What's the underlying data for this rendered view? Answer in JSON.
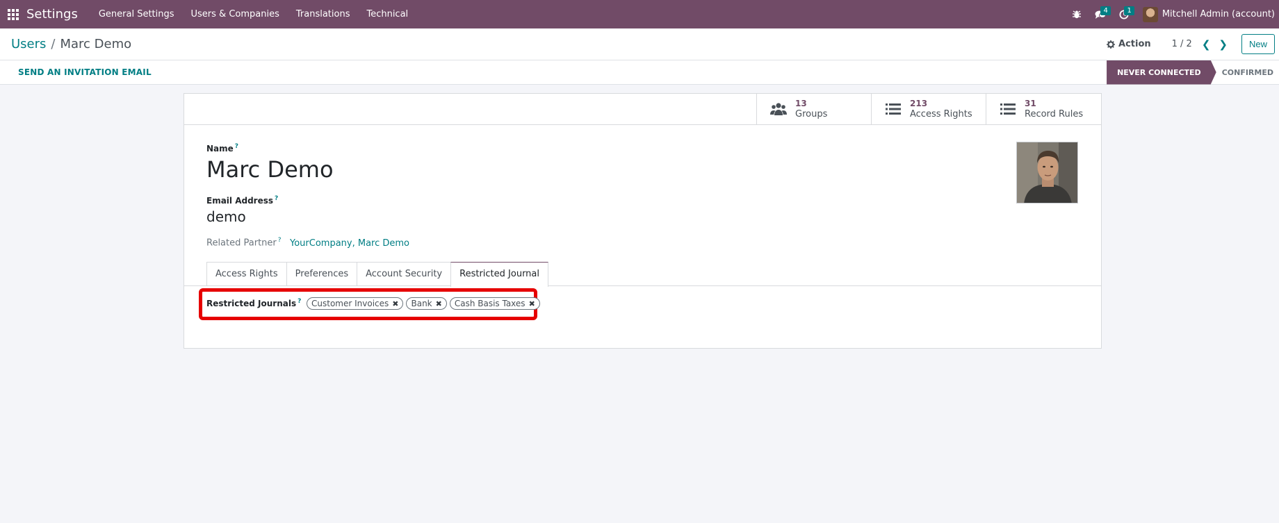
{
  "navbar": {
    "app_name": "Settings",
    "menu": [
      "General Settings",
      "Users & Companies",
      "Translations",
      "Technical"
    ],
    "chat_count": "4",
    "activity_count": "1",
    "user": "Mitchell Admin (account)"
  },
  "control_panel": {
    "breadcrumb_parent": "Users",
    "breadcrumb_separator": "/",
    "breadcrumb_current": "Marc Demo",
    "action_label": "Action",
    "pager": "1 / 2",
    "new_label": "New"
  },
  "statusbar": {
    "invite_label": "SEND AN INVITATION EMAIL",
    "steps": [
      "NEVER CONNECTED",
      "CONFIRMED"
    ]
  },
  "stat_buttons": [
    {
      "value": "13",
      "label": "Groups",
      "icon": "users-icon"
    },
    {
      "value": "213",
      "label": "Access Rights",
      "icon": "list-icon"
    },
    {
      "value": "31",
      "label": "Record Rules",
      "icon": "list-icon"
    }
  ],
  "form": {
    "name_label": "Name",
    "name_value": "Marc Demo",
    "email_label": "Email Address",
    "email_value": "demo",
    "partner_label": "Related Partner",
    "partner_value": "YourCompany, Marc Demo",
    "help_mark": "?"
  },
  "tabs": [
    "Access Rights",
    "Preferences",
    "Account Security",
    "Restricted Journal"
  ],
  "restricted": {
    "label": "Restricted Journals",
    "tags": [
      "Customer Invoices",
      "Bank",
      "Cash Basis Taxes"
    ]
  },
  "colors": {
    "brand": "#714b67",
    "accent": "#017e84",
    "highlight": "#e60000"
  }
}
